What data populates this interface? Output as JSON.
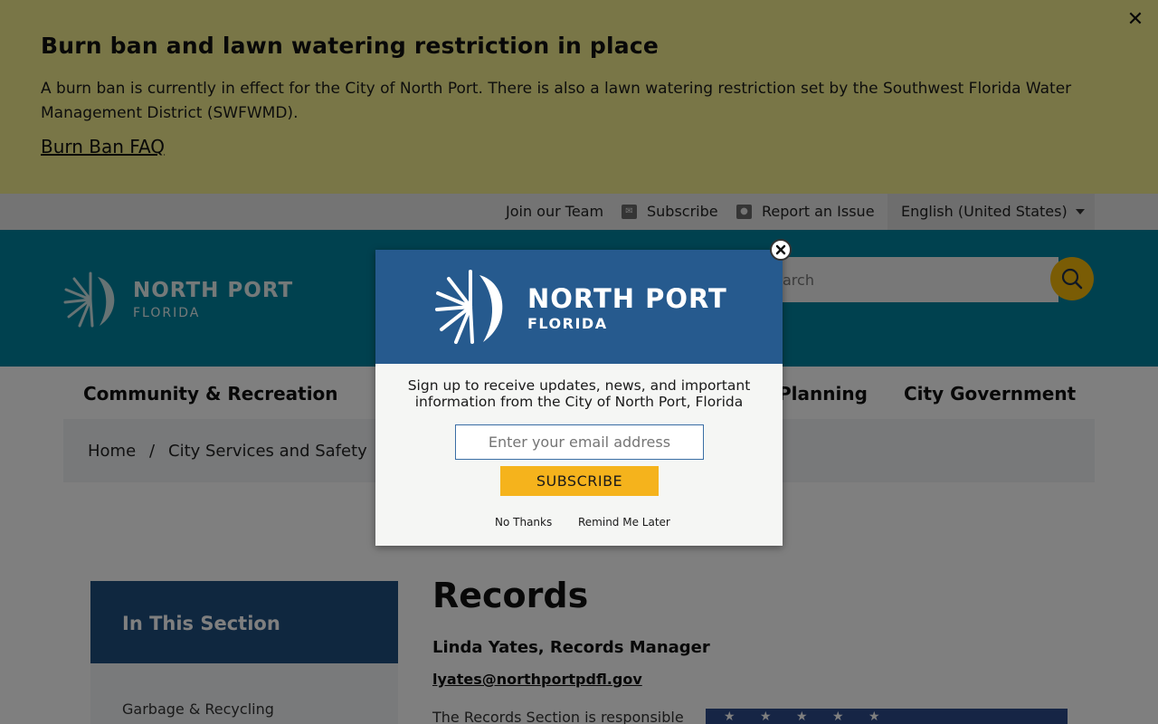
{
  "alert": {
    "title": "Burn ban and lawn watering restriction in place",
    "body": "A burn ban is currently in effect for the City of North Port. There is also a lawn watering restriction set by the Southwest Florida Water Management District (SWFWMD).",
    "link": "Burn Ban FAQ",
    "close_icon": "close-icon"
  },
  "utility": {
    "join": "Join our Team",
    "subscribe": "Subscribe",
    "report": "Report an Issue",
    "language": "English (United States)"
  },
  "header": {
    "logo_line1": "NORTH PORT",
    "logo_line2": "FLORIDA",
    "search_placeholder": "Search"
  },
  "nav": {
    "items": [
      "Community & Recreation",
      "Planning",
      "City Government"
    ]
  },
  "breadcrumb": {
    "home": "Home",
    "separator": "/",
    "section": "City Services and Safety"
  },
  "sidebar": {
    "heading": "In This Section",
    "items": [
      "Garbage & Recycling"
    ]
  },
  "content": {
    "title": "Records",
    "name": "Linda Yates, Records Manager",
    "email": "lyates@northportpdfl.gov",
    "text": "The Records Section is responsible"
  },
  "modal": {
    "logo_line1": "NORTH PORT",
    "logo_line2": "FLORIDA",
    "message": "Sign up to receive updates, news, and important information from the City of North Port, Florida",
    "email_placeholder": "Enter your email address",
    "subscribe": "SUBSCRIBE",
    "no_thanks": "No Thanks",
    "remind": "Remind Me Later"
  },
  "colors": {
    "alert_bg": "#f2ec8f",
    "header_bg": "#00839e",
    "modal_top": "#265a8e",
    "accent": "#f5b31c",
    "sidebar_head": "#1f4f7f"
  }
}
